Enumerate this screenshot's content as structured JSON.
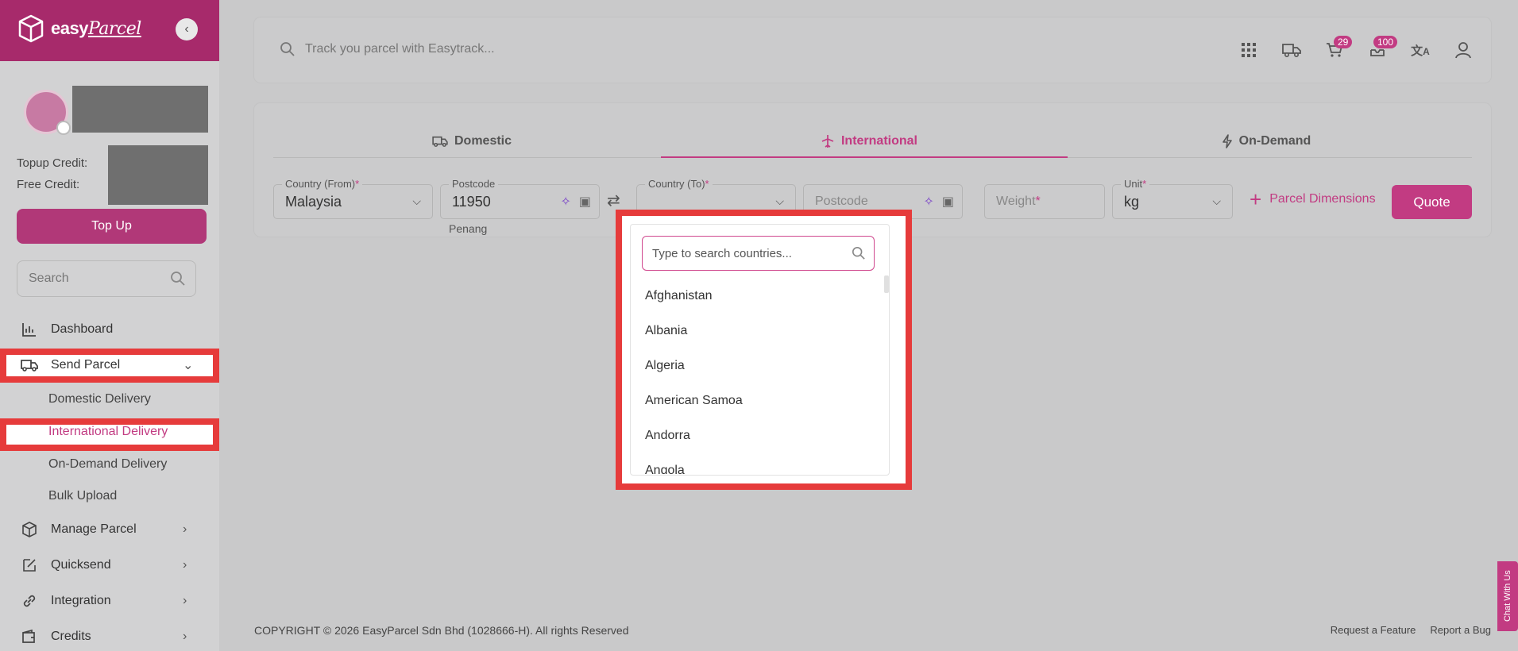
{
  "brand": {
    "name": "easy",
    "name_script": "Parcel"
  },
  "sidebar": {
    "topup_credit_label": "Topup Credit:",
    "free_credit_label": "Free Credit:",
    "topup_button": "Top Up",
    "search_placeholder": "Search",
    "nav": [
      {
        "label": "Dashboard",
        "icon": "chart-icon"
      },
      {
        "label": "Send Parcel",
        "icon": "truck-icon"
      },
      {
        "label": "Manage Parcel",
        "icon": "box-icon"
      },
      {
        "label": "Quicksend",
        "icon": "edit-icon"
      },
      {
        "label": "Integration",
        "icon": "link-icon"
      },
      {
        "label": "Credits",
        "icon": "wallet-icon"
      }
    ],
    "send_parcel_sub": [
      "Domestic Delivery",
      "International Delivery",
      "On-Demand Delivery",
      "Bulk Upload"
    ]
  },
  "topbar": {
    "track_placeholder": "Track you parcel with Easytrack...",
    "cart_count": "29",
    "notifications_count": "100"
  },
  "tabs": [
    "Domestic",
    "International",
    "On-Demand"
  ],
  "form": {
    "country_from_label": "Country (From)",
    "country_from_value": "Malaysia",
    "postcode_label": "Postcode",
    "postcode_value": "11950",
    "postcode_hint": "Penang",
    "country_to_label": "Country (To)",
    "postcode_to_placeholder": "Postcode",
    "weight_placeholder": "Weight",
    "unit_label": "Unit",
    "unit_value": "kg",
    "parcel_dimensions": "Parcel Dimensions",
    "quote_button": "Quote",
    "required_mark": "*"
  },
  "dropdown": {
    "search_placeholder": "Type to search countries...",
    "countries": [
      "Afghanistan",
      "Albania",
      "Algeria",
      "American Samoa",
      "Andorra",
      "Angola"
    ]
  },
  "footer": {
    "copyright": "COPYRIGHT © 2026 EasyParcel Sdn Bhd (1028666-H). All rights Reserved",
    "request_feature": "Request a Feature",
    "report_bug": "Report a Bug",
    "chat": "Chat With Us"
  },
  "colors": {
    "brand": "#c23b82",
    "highlight": "#e63b3b"
  }
}
